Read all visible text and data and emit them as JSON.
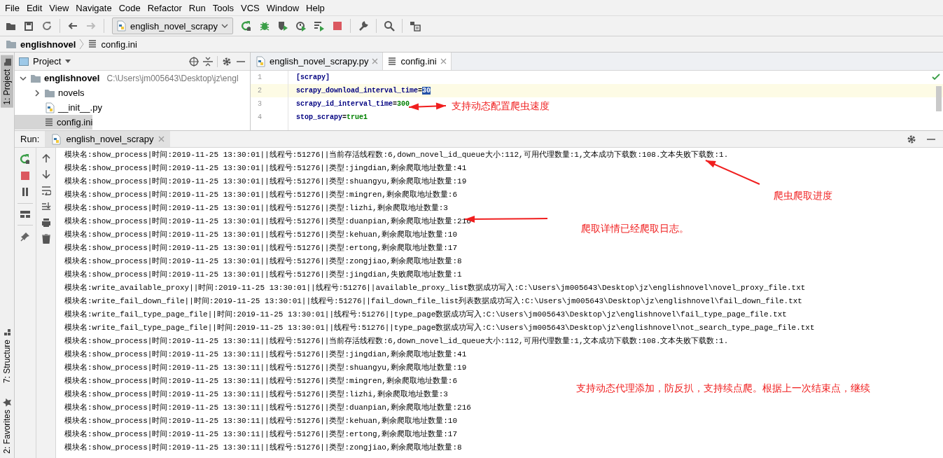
{
  "menu": [
    {
      "label": "File"
    },
    {
      "label": "Edit"
    },
    {
      "label": "View"
    },
    {
      "label": "Navigate"
    },
    {
      "label": "Code"
    },
    {
      "label": "Refactor"
    },
    {
      "label": "Run"
    },
    {
      "label": "Tools"
    },
    {
      "label": "VCS"
    },
    {
      "label": "Window"
    },
    {
      "label": "Help"
    }
  ],
  "toolbar": {
    "run_config": "english_novel_scrapy"
  },
  "breadcrumb": [
    {
      "label": "englishnovel",
      "kind": "folder"
    },
    {
      "label": "config.ini",
      "kind": "file"
    }
  ],
  "side_tabs": [
    {
      "label": "1: Project",
      "selected": true,
      "kind": "project"
    },
    {
      "label": "7: Structure",
      "selected": false,
      "kind": "structure"
    },
    {
      "label": "2: Favorites",
      "selected": false,
      "kind": "favorites"
    }
  ],
  "project": {
    "title": "Project",
    "tree": [
      {
        "name": "englishnovel",
        "path": "C:\\Users\\jm005643\\Desktop\\jz\\engl",
        "kind": "folder",
        "expanded": true,
        "selected": false,
        "children": [
          {
            "name": "novels",
            "kind": "folder",
            "expanded": false,
            "selected": false
          },
          {
            "name": "__init__.py",
            "kind": "python",
            "selected": false
          },
          {
            "name": "config.ini",
            "kind": "ini",
            "selected": true
          }
        ]
      }
    ]
  },
  "editor": {
    "tabs": [
      {
        "label": "english_novel_scrapy.py",
        "kind": "python",
        "selected": false
      },
      {
        "label": "config.ini",
        "kind": "ini",
        "selected": true
      }
    ],
    "lines": [
      {
        "number": "1",
        "kind": "section",
        "key": "[scrapy]",
        "current": false
      },
      {
        "number": "2",
        "kind": "pair",
        "key": "scrapy_download_interval_time",
        "separator": "=",
        "value": "30",
        "current": true,
        "value_selected": true
      },
      {
        "number": "3",
        "kind": "pair",
        "key": "scrapy_id_interval_time",
        "separator": "=",
        "value": "300",
        "current": false,
        "value_selected": false
      },
      {
        "number": "4",
        "kind": "pair",
        "key": "stop_scrapy",
        "separator": "=",
        "value": "true1",
        "current": false,
        "value_selected": false
      }
    ]
  },
  "run": {
    "label": "Run:",
    "tab": "english_novel_scrapy",
    "log": [
      "模块名:show_process|时间:2019-11-25 13:30:01||线程号:51276||当前存活线程数:6,down_novel_id_queue大小:112,可用代理数量:1,文本成功下载数:108.文本失败下载数:1.",
      "模块名:show_process|时间:2019-11-25 13:30:01||线程号:51276||类型:jingdian,剩余爬取地址数量:41",
      "模块名:show_process|时间:2019-11-25 13:30:01||线程号:51276||类型:shuangyu,剩余爬取地址数量:19",
      "模块名:show_process|时间:2019-11-25 13:30:01||线程号:51276||类型:mingren,剩余爬取地址数量:6",
      "模块名:show_process|时间:2019-11-25 13:30:01||线程号:51276||类型:lizhi,剩余爬取地址数量:3",
      "模块名:show_process|时间:2019-11-25 13:30:01||线程号:51276||类型:duanpian,剩余爬取地址数量:216",
      "模块名:show_process|时间:2019-11-25 13:30:01||线程号:51276||类型:kehuan,剩余爬取地址数量:10",
      "模块名:show_process|时间:2019-11-25 13:30:01||线程号:51276||类型:ertong,剩余爬取地址数量:17",
      "模块名:show_process|时间:2019-11-25 13:30:01||线程号:51276||类型:zongjiao,剩余爬取地址数量:8",
      "模块名:show_process|时间:2019-11-25 13:30:01||线程号:51276||类型:jingdian,失败爬取地址数量:1",
      "模块名:write_available_proxy||时间:2019-11-25 13:30:01||线程号:51276||available_proxy_list数据成功写入:C:\\Users\\jm005643\\Desktop\\jz\\englishnovel\\novel_proxy_file.txt",
      "模块名:write_fail_down_file||时间:2019-11-25 13:30:01||线程号:51276||fail_down_file_list列表数据成功写入:C:\\Users\\jm005643\\Desktop\\jz\\englishnovel\\fail_down_file.txt",
      "模块名:write_fail_type_page_file||时间:2019-11-25 13:30:01||线程号:51276||type_page数据成功写入:C:\\Users\\jm005643\\Desktop\\jz\\englishnovel\\fail_type_page_file.txt",
      "模块名:write_fail_type_page_file||时间:2019-11-25 13:30:01||线程号:51276||type_page数据成功写入:C:\\Users\\jm005643\\Desktop\\jz\\englishnovel\\not_search_type_page_file.txt",
      "模块名:show_process|时间:2019-11-25 13:30:11||线程号:51276||当前存活线程数:6,down_novel_id_queue大小:112,可用代理数量:1,文本成功下载数:108.文本失败下载数:1.",
      "模块名:show_process|时间:2019-11-25 13:30:11||线程号:51276||类型:jingdian,剩余爬取地址数量:41",
      "模块名:show_process|时间:2019-11-25 13:30:11||线程号:51276||类型:shuangyu,剩余爬取地址数量:19",
      "模块名:show_process|时间:2019-11-25 13:30:11||线程号:51276||类型:mingren,剩余爬取地址数量:6",
      "模块名:show_process|时间:2019-11-25 13:30:11||线程号:51276||类型:lizhi,剩余爬取地址数量:3",
      "模块名:show_process|时间:2019-11-25 13:30:11||线程号:51276||类型:duanpian,剩余爬取地址数量:216",
      "模块名:show_process|时间:2019-11-25 13:30:11||线程号:51276||类型:kehuan,剩余爬取地址数量:10",
      "模块名:show_process|时间:2019-11-25 13:30:11||线程号:51276||类型:ertong,剩余爬取地址数量:17",
      "模块名:show_process|时间:2019-11-25 13:30:11||线程号:51276||类型:zongjiao,剩余爬取地址数量:8"
    ]
  },
  "callouts": [
    {
      "text": "支持动态配置爬虫速度",
      "kind": "double-arrow"
    },
    {
      "text": "爬虫爬取进度",
      "kind": "arrow"
    },
    {
      "text": "爬取详情已经爬取日志。",
      "kind": "arrow"
    },
    {
      "text": "支持动态代理添加，防反扒，支持续点爬。根据上一次结束点，继续",
      "kind": "plain"
    }
  ]
}
